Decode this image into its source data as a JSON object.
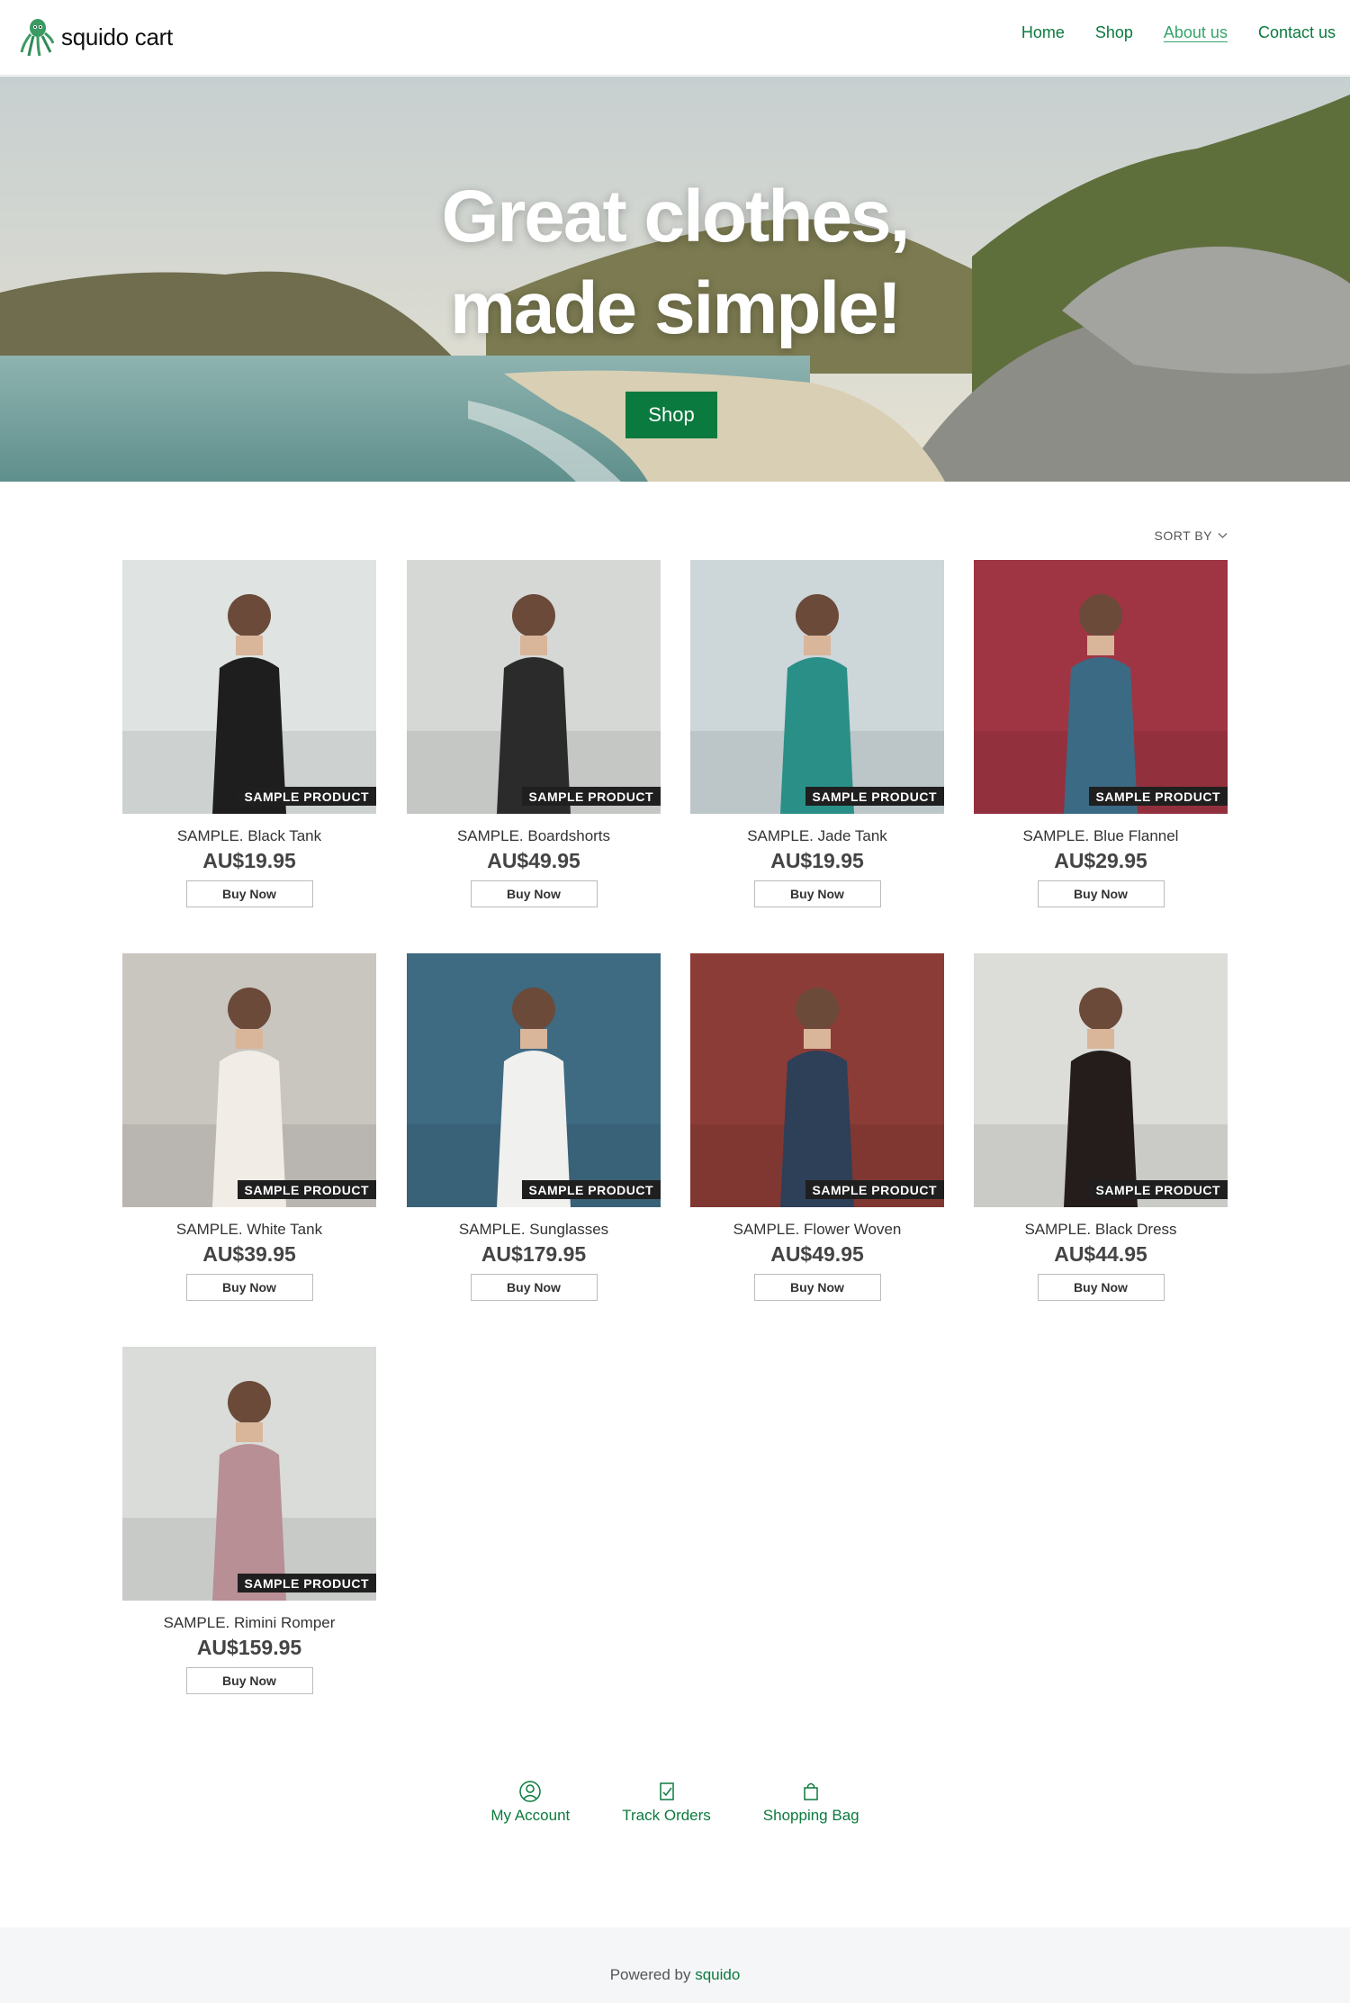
{
  "site": {
    "name": "squido cart",
    "logo_icon": "octopus-icon"
  },
  "nav": [
    {
      "label": "Home"
    },
    {
      "label": "Shop"
    },
    {
      "label": "About us"
    },
    {
      "label": "Contact us"
    }
  ],
  "hero": {
    "line1": "Great clothes,",
    "line2": "made simple!",
    "button": "Shop"
  },
  "sort_label": "SORT BY",
  "products": [
    {
      "name": "SAMPLE. Black Tank",
      "price": "AU$19.95",
      "badge": "SAMPLE PRODUCT",
      "button": "Buy Now",
      "bg": "#dfe3e2",
      "fg": "#1e1e1e"
    },
    {
      "name": "SAMPLE. Boardshorts",
      "price": "AU$49.95",
      "badge": "SAMPLE PRODUCT",
      "button": "Buy Now",
      "bg": "#d6d8d6",
      "fg": "#2b2b2b"
    },
    {
      "name": "SAMPLE. Jade Tank",
      "price": "AU$19.95",
      "badge": "SAMPLE PRODUCT",
      "button": "Buy Now",
      "bg": "#cdd6d9",
      "fg": "#2a8f86"
    },
    {
      "name": "SAMPLE. Blue Flannel",
      "price": "AU$29.95",
      "badge": "SAMPLE PRODUCT",
      "button": "Buy Now",
      "bg": "#9f3543",
      "fg": "#3b6a85"
    },
    {
      "name": "SAMPLE. White Tank",
      "price": "AU$39.95",
      "badge": "SAMPLE PRODUCT",
      "button": "Buy Now",
      "bg": "#c9c6c0",
      "fg": "#f1ede6"
    },
    {
      "name": "SAMPLE. Sunglasses",
      "price": "AU$179.95",
      "badge": "SAMPLE PRODUCT",
      "button": "Buy Now",
      "bg": "#3e6a82",
      "fg": "#f0f0ee"
    },
    {
      "name": "SAMPLE. Flower Woven",
      "price": "AU$49.95",
      "badge": "SAMPLE PRODUCT",
      "button": "Buy Now",
      "bg": "#8c3c36",
      "fg": "#2e3f58"
    },
    {
      "name": "SAMPLE. Black Dress",
      "price": "AU$44.95",
      "badge": "SAMPLE PRODUCT",
      "button": "Buy Now",
      "bg": "#dcdcd8",
      "fg": "#241d1b"
    },
    {
      "name": "SAMPLE. Rimini Romper",
      "price": "AU$159.95",
      "badge": "SAMPLE PRODUCT",
      "button": "Buy Now",
      "bg": "#d9dcd9",
      "fg": "#b88f95"
    }
  ],
  "bottom_links": [
    {
      "label": "My Account",
      "icon": "user-circle-icon"
    },
    {
      "label": "Track Orders",
      "icon": "clipboard-check-icon"
    },
    {
      "label": "Shopping Bag",
      "icon": "shopping-bag-icon"
    }
  ],
  "footer": {
    "prefix": "Powered by",
    "brand": "squido"
  },
  "colors": {
    "accent": "#0b7a3e",
    "badge_bg": "#1f1f1f",
    "footer_bg": "#f5f6f8"
  }
}
